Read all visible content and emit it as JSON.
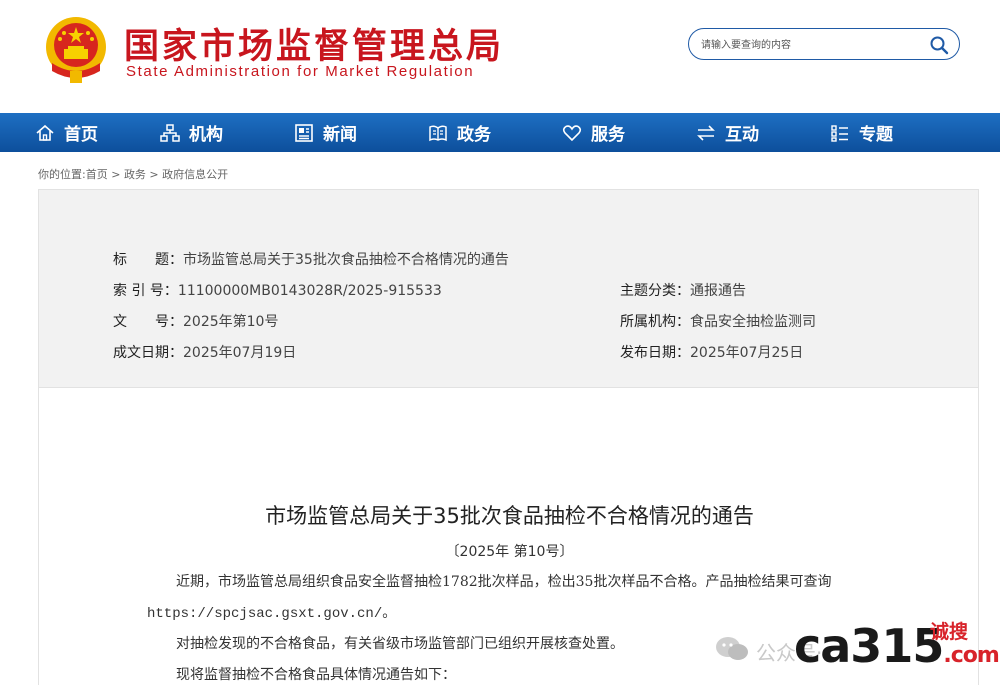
{
  "header": {
    "title_cn": "国家市场监督管理总局",
    "title_en": "State Administration for Market Regulation",
    "search_placeholder": "请输入要查询的内容"
  },
  "nav": [
    {
      "label": "首页",
      "icon": "home-icon"
    },
    {
      "label": "机构",
      "icon": "org-chart-icon"
    },
    {
      "label": "新闻",
      "icon": "newspaper-icon"
    },
    {
      "label": "政务",
      "icon": "book-icon"
    },
    {
      "label": "服务",
      "icon": "heart-icon"
    },
    {
      "label": "互动",
      "icon": "exchange-arrows-icon"
    },
    {
      "label": "专题",
      "icon": "list-icon"
    }
  ],
  "breadcrumb": {
    "prefix": "你的位置:",
    "items": [
      "首页",
      "政务",
      "政府信息公开"
    ],
    "sep": " > "
  },
  "meta": {
    "title_label": "标　　题：",
    "title_value": "市场监管总局关于35批次食品抽检不合格情况的通告",
    "index_label": "索  引  号：",
    "index_value": "11100000MB0143028R/2025-915533",
    "doc_label": "文　　号：",
    "doc_value": "2025年第10号",
    "made_label": "成文日期：",
    "made_value": "2025年07月19日",
    "topic_label": "主题分类：",
    "topic_value": "通报通告",
    "org_label": "所属机构：",
    "org_value": "食品安全抽检监测司",
    "pub_label": "发布日期：",
    "pub_value": "2025年07月25日"
  },
  "article": {
    "title": "市场监管总局关于35批次食品抽检不合格情况的通告",
    "number": "〔2025年 第10号〕",
    "p1": "近期，市场监管总局组织食品安全监督抽检1782批次样品，检出35批次样品不合格。产品抽检结果可查询",
    "p1_url": "https://spcjsac.gsxt.gov.cn/",
    "p1_end": "。",
    "p2": "对抽检发现的不合格食品，有关省级市场监管部门已组织开展核查处置。",
    "p3": "现将监督抽检不合格食品具体情况通告如下："
  },
  "watermark": {
    "gzh": "公众号·",
    "logo": "ca315",
    "dot_com": ".com",
    "cs": "诚搜"
  },
  "colors": {
    "brand_red": "#c8161e",
    "nav_blue": "#1565b5"
  }
}
